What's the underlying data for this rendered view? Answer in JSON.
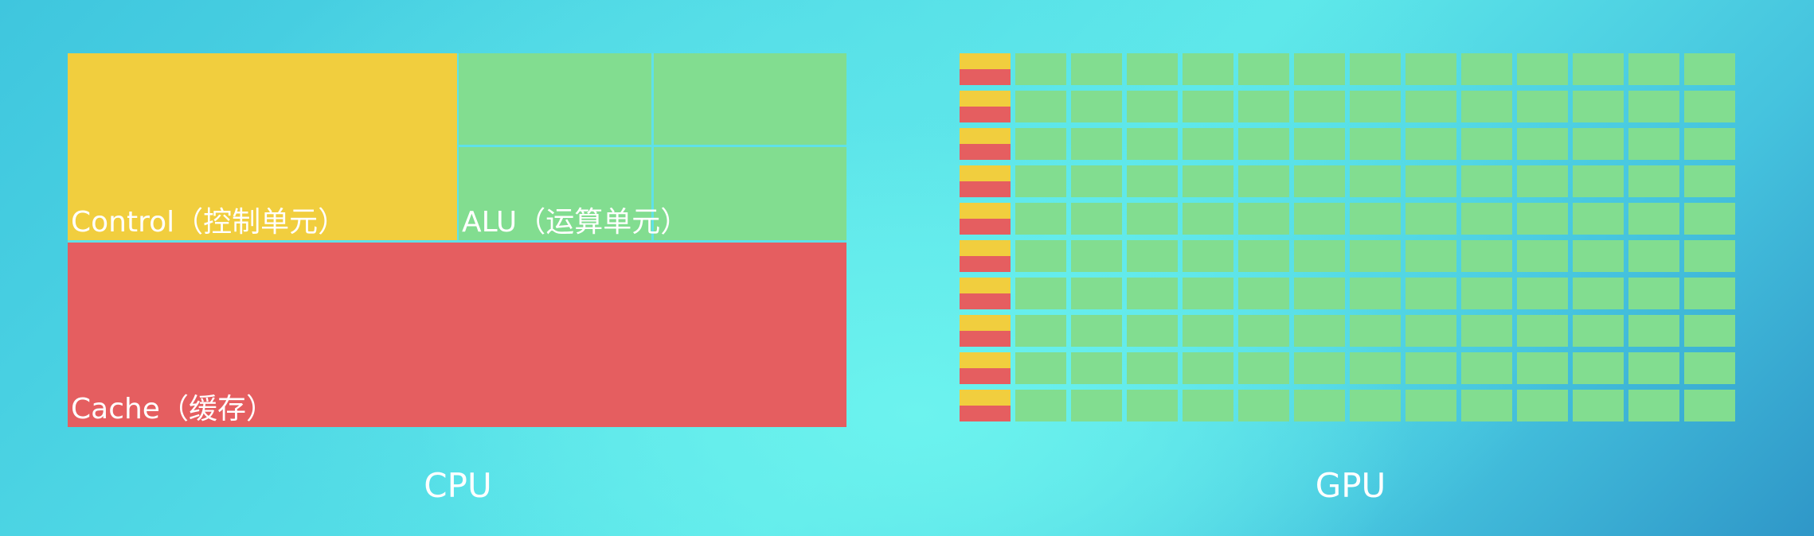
{
  "cpu": {
    "caption": "CPU",
    "control_label": "Control（控制单元）",
    "alu_label": "ALU（运算单元）",
    "cache_label": "Cache（缓存）",
    "colors": {
      "control": "#f1ce3e",
      "alu": "#82dd90",
      "cache": "#e55e60"
    },
    "alu_cells": 4
  },
  "gpu": {
    "caption": "GPU",
    "rows": 10,
    "alu_per_row": 13,
    "colors": {
      "control": "#f1ce3e",
      "alu": "#82dd90",
      "cache": "#e55e60"
    }
  }
}
